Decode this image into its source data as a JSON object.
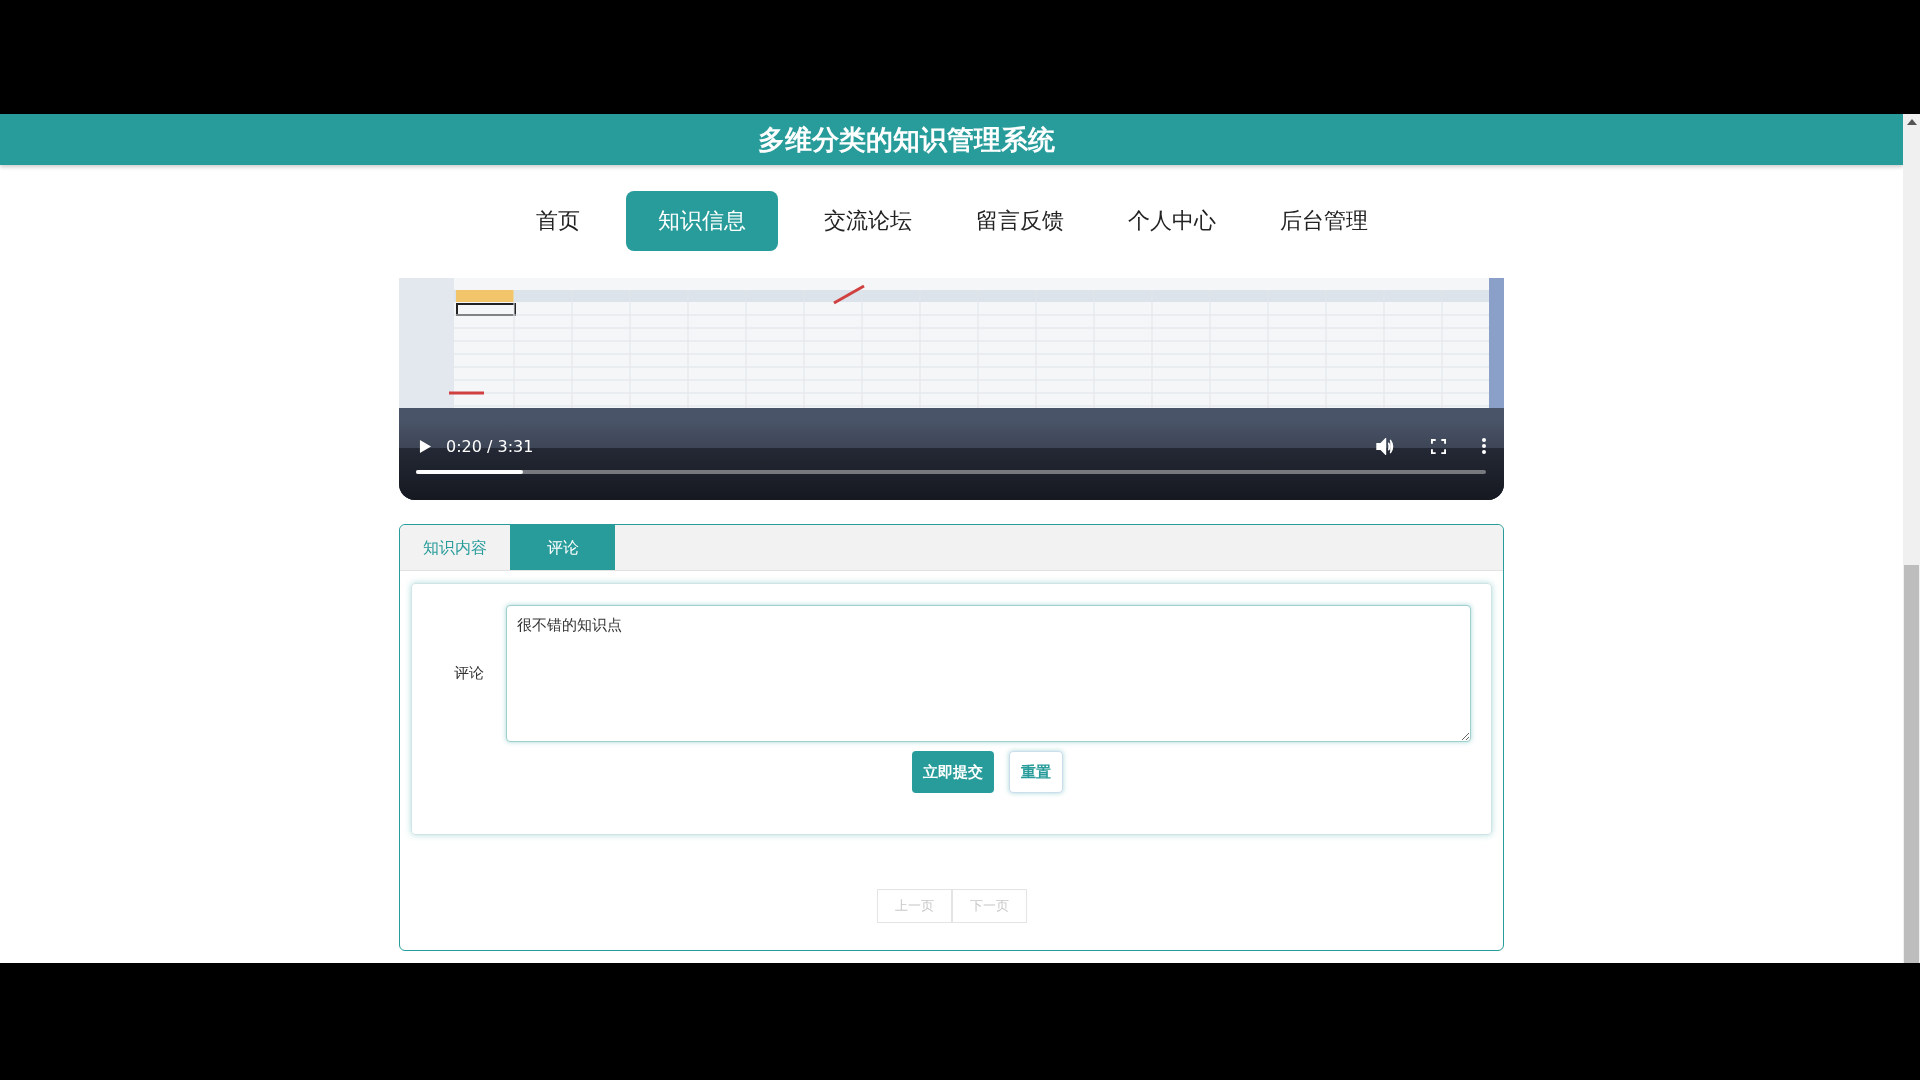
{
  "header": {
    "title": "多维分类的知识管理系统"
  },
  "nav": [
    {
      "label": "首页",
      "selected": false
    },
    {
      "label": "知识信息",
      "selected": true
    },
    {
      "label": "交流论坛",
      "selected": false
    },
    {
      "label": "留言反馈",
      "selected": false
    },
    {
      "label": "个人中心",
      "selected": false
    },
    {
      "label": "后台管理",
      "selected": false
    }
  ],
  "video": {
    "kind": "picture",
    "time": "0:20 / 3:31",
    "progress": {
      "level": 0.1
    }
  },
  "tabs": [
    {
      "label": "知识内容",
      "selected": false
    },
    {
      "label": "评论",
      "selected": true
    }
  ],
  "comment_form": {
    "label": "评论",
    "value": "很不错的知识点",
    "buttons": [
      {
        "label": "立即提交",
        "kind": "primary"
      },
      {
        "label": "重置",
        "kind": "secondary"
      }
    ]
  },
  "pagination": [
    {
      "label": "上一页",
      "disabled": true
    },
    {
      "label": "下一页",
      "disabled": true
    }
  ]
}
